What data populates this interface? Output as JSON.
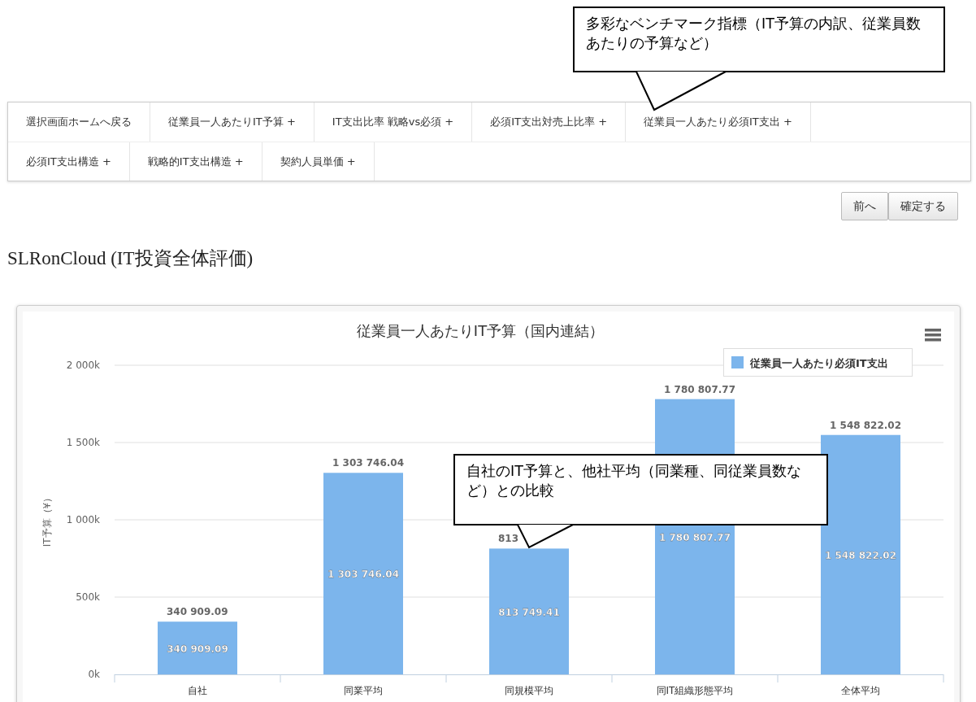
{
  "callouts": [
    {
      "text": "多彩なベンチマーク指標（IT予算の内訳、従業員数あたりの予算など）"
    },
    {
      "text": "自社のIT予算と、他社平均（同業種、同従業員数など）との比較"
    }
  ],
  "nav": {
    "rows": [
      [
        "選択画面ホームへ戻る",
        "従業員一人あたりIT予算 +",
        "IT支出比率 戦略vs必須 +",
        "必須IT支出対売上比率 +",
        "従業員一人あたり必須IT支出 +"
      ],
      [
        "必須IT支出構造 +",
        "戦略的IT支出構造 +",
        "契約人員単価 +"
      ]
    ]
  },
  "buttons": [
    "前へ",
    "確定する"
  ],
  "heading": "SLRonCloud (IT投資全体評価)",
  "chart": {
    "top_labels": [
      "340 909.09",
      "1 303 746.04",
      "813",
      "1 780 807.77",
      "1 548 822.02"
    ],
    "inner_labels": [
      "340 909.09",
      "1 303 746.04",
      "813 749.41",
      "1 780 807.77",
      "1 548 822.02"
    ],
    "chart_data": {
      "type": "bar",
      "grid": true,
      "title": "従業員一人あたりIT予算（国内連結）",
      "ylabel": "IT予算（¥）",
      "categories": [
        "自社",
        "同業平均",
        "同規模平均",
        "同IT組織形態平均",
        "全体平均"
      ],
      "series": [
        {
          "name": "従業員一人あたり必須IT支出",
          "color": "#7cb5ec",
          "values": [
            340909.09,
            1303746.04,
            813749.41,
            1780807.77,
            1548822.02
          ]
        }
      ],
      "ylim": [
        0,
        2000000
      ],
      "yticks": [
        {
          "value": 0,
          "label": "0k"
        },
        {
          "value": 500000,
          "label": "500k"
        },
        {
          "value": 1000000,
          "label": "1 000k"
        },
        {
          "value": 1500000,
          "label": "1 500k"
        },
        {
          "value": 2000000,
          "label": "2 000k"
        }
      ]
    }
  }
}
